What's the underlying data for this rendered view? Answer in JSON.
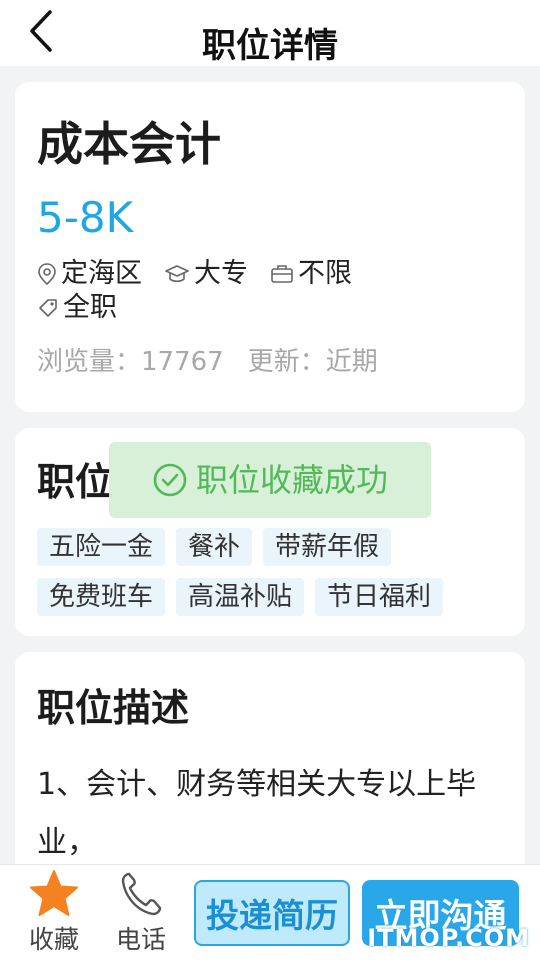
{
  "header": {
    "title": "职位详情"
  },
  "job": {
    "title": "成本会计",
    "salary": "5-8K",
    "location": "定海区",
    "education": "大专",
    "experience": "不限",
    "job_type": "全职",
    "views_label": "浏览量：",
    "views_value": "17767",
    "update_label": "更新：",
    "update_value": "近期"
  },
  "benefits": {
    "title_visible": "职位",
    "rows": [
      [
        "五险一金",
        "餐补",
        "带薪年假"
      ],
      [
        "免费班车",
        "高温补贴",
        "节日福利"
      ]
    ]
  },
  "toast": {
    "text": "职位收藏成功"
  },
  "description": {
    "title": "职位描述",
    "text": "1、会计、财务等相关大专以上毕业，"
  },
  "bottom_bar": {
    "favorite_label": "收藏",
    "phone_label": "电话",
    "resume_button": "投递简历",
    "chat_button": "立即沟通"
  },
  "watermark": "ITMOP.COM",
  "colors": {
    "accent": "#1ea7e4",
    "star": "#f58220",
    "toast_text": "#52b95a",
    "toast_bg": "#d6eed6"
  },
  "icons": {
    "back": "chevron-left-icon",
    "location": "location-pin-icon",
    "education": "graduation-cap-icon",
    "experience": "briefcase-icon",
    "job_type": "tag-icon",
    "toast": "check-circle-icon",
    "favorite": "star-icon",
    "phone": "phone-icon"
  }
}
